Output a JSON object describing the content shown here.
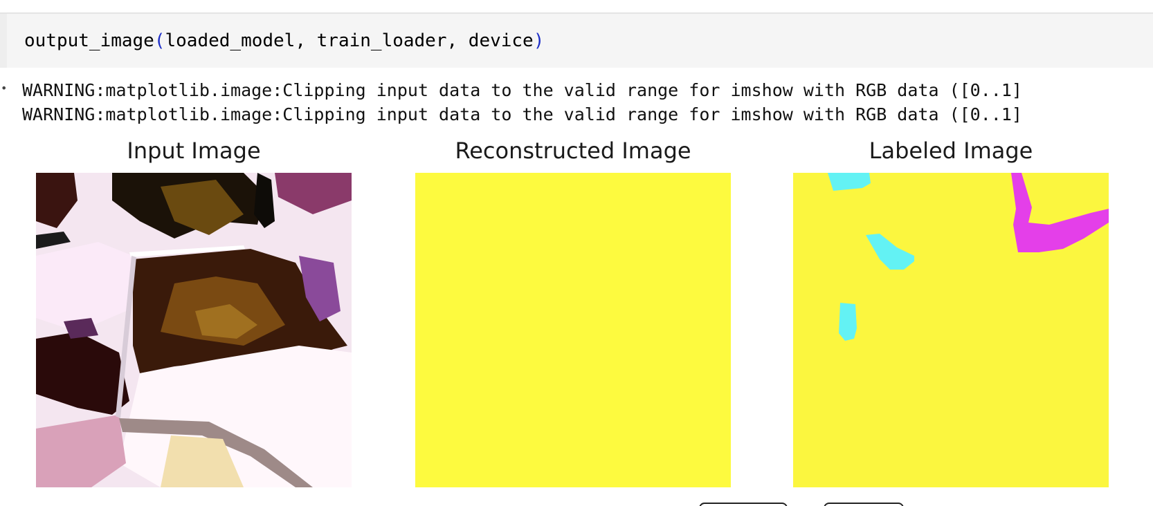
{
  "code_cell": {
    "fn_name": "output_image",
    "open_paren": "(",
    "args": "loaded_model, train_loader, device",
    "close_paren": ")"
  },
  "output": {
    "warnings": [
      "WARNING:matplotlib.image:Clipping input data to the valid range for imshow with RGB data ([0..1]",
      "WARNING:matplotlib.image:Clipping input data to the valid range for imshow with RGB data ([0..1]"
    ],
    "panels": [
      {
        "title": "Input Image"
      },
      {
        "title": "Reconstructed Image"
      },
      {
        "title": "Labeled Image"
      }
    ]
  },
  "colors": {
    "code_bg": "#f5f5f5",
    "paren": "#1e2fc8",
    "recon_yellow": "#fdfa3f",
    "label_yellow": "#fbf63f",
    "label_cyan": "#63f2f4",
    "label_magenta": "#e43fe9"
  }
}
